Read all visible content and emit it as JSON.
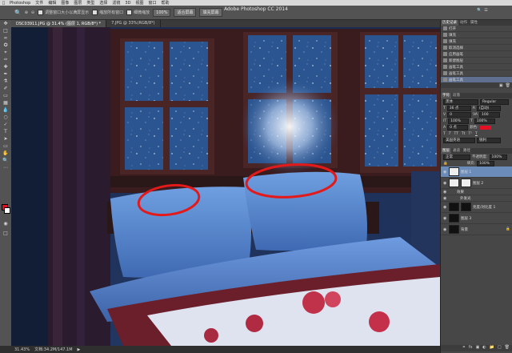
{
  "menubar": {
    "items": [
      "Photoshop",
      "文件",
      "编辑",
      "图像",
      "图层",
      "类型",
      "选择",
      "滤镜",
      "3D",
      "视图",
      "窗口",
      "帮助"
    ]
  },
  "app_title": "Adobe Photoshop CC 2014",
  "options_bar": {
    "checkbox1_label": "调整窗口大小以满屏显示",
    "checkbox2_label": "缩放所有窗口",
    "checkbox3_label": "细微缩放",
    "btn_100": "100%",
    "btn_fit": "适合屏幕",
    "btn_fill": "填充屏幕"
  },
  "tabs": [
    {
      "label": "DSC03911.JPG @ 31.4% (图层 1, RGB/8*) *",
      "active": true
    },
    {
      "label": "7.JPG @ 33%(RGB/8*)",
      "active": false
    }
  ],
  "status": {
    "zoom": "31.43%",
    "doc": "文档:34.2M/147.1M"
  },
  "history": {
    "tabs": [
      "历史记录",
      "动作",
      "属性"
    ],
    "items": [
      "打开",
      "填充",
      "填充",
      "取消选择",
      "应用画笔",
      "新建图层",
      "画笔工具",
      "画笔工具",
      "画笔工具"
    ]
  },
  "character": {
    "tabs": [
      "字符",
      "段落"
    ],
    "font": "黑体",
    "style": "Regular",
    "size": "36 点",
    "leading": "(自动)",
    "tracking": "0",
    "kerning": "100",
    "scale_v": "100%",
    "scale_h": "100%",
    "baseline": "0 点",
    "color_label": "颜色:",
    "language": "美国英语",
    "aa": "锐利"
  },
  "layers": {
    "tabs": [
      "图层",
      "通道",
      "路径"
    ],
    "blend": "正常",
    "opacity_label": "不透明度:",
    "opacity": "100%",
    "fill_label": "填充:",
    "fill": "100%",
    "rows": [
      {
        "name": "图层 1",
        "selected": true
      },
      {
        "name": "图层 2",
        "selected": false
      },
      {
        "name": "效果",
        "selected": false
      },
      {
        "name": "外发光",
        "selected": false
      },
      {
        "name": "亮度/对比度 1",
        "selected": false
      },
      {
        "name": "图层 3",
        "selected": false
      },
      {
        "name": "背景",
        "selected": false
      }
    ]
  },
  "colors": {
    "accent": "#e30f24",
    "annotation": "#e41a1a",
    "night": "#1a2c52",
    "moon": "#eef4ff"
  }
}
